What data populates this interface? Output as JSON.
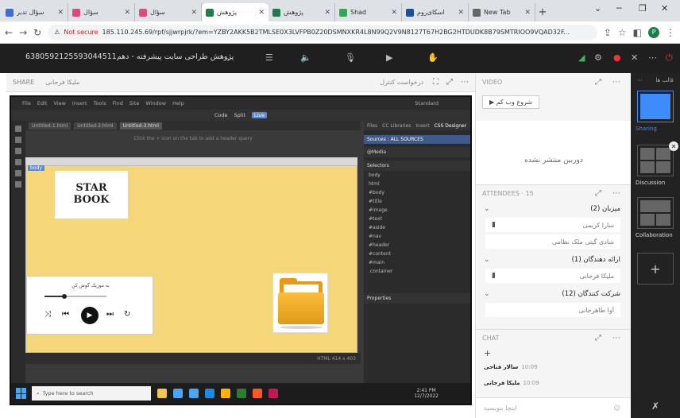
{
  "browser": {
    "tabs": [
      {
        "title": "سؤال تدبر",
        "color": "#3b6fd6"
      },
      {
        "title": "سؤال",
        "color": "#e04a7a"
      },
      {
        "title": "سؤال",
        "color": "#e04a7a"
      },
      {
        "title": "پژوهش",
        "color": "#1a7f4b"
      },
      {
        "title": "پژوهش",
        "color": "#1a7f4b"
      },
      {
        "title": "Shad",
        "color": "#2fa84f"
      },
      {
        "title": "اسکای‌روم",
        "color": "#1d4fa0"
      },
      {
        "title": "New Tab",
        "color": "#666666"
      }
    ],
    "active_tab": 3,
    "new_tab": "+",
    "window_controls": [
      "⌄",
      "─",
      "❐",
      "✕"
    ],
    "not_secure": "Not secure",
    "url": "185.110.245.69/rpf/sjjwrpjrk/?em=YZBY2AKK5B2TMLSE0X3LVFPB0Z20DSMNXKR4L8N99Q2V9N8127T67H2BG2HTDUDK8B79SMTRIOO9VQAD32F...",
    "profile_initial": "P"
  },
  "meeting": {
    "room_title": "6380592125593044511پژوهش طراحی سایت پیشرفته - دهم"
  },
  "share": {
    "label": "SHARE",
    "presenter": "ملیکا فرجانی",
    "request_control": "درخواست کنترل"
  },
  "dreamweaver": {
    "menu": [
      "File",
      "Edit",
      "View",
      "Insert",
      "Tools",
      "Find",
      "Site",
      "Window",
      "Help"
    ],
    "workspace": "Standard",
    "mode_tabs": [
      "Code",
      "Split",
      "Live"
    ],
    "active_mode": "Live",
    "doc_tabs": [
      "Untitled-1.html",
      "Untitled-2.html",
      "Untitled-3.html"
    ],
    "hint": "Click the + icon on the tab to add a header query",
    "body_tag": "body",
    "star_line1": "STAR",
    "star_line2": "BOOK",
    "player_title": "به موزیک گوش کن",
    "player_progress": 0.32,
    "status": "HTML   414 x 403",
    "panel_tabs": [
      "Files",
      "CC Libraries",
      "Insert",
      "CSS Designer"
    ],
    "panel_active": "CSS Designer",
    "panel_rows": [
      "Sources : ALL SOURCES",
      "@Media",
      "Selectors",
      "Properties"
    ],
    "panel_items": [
      "body",
      "html",
      "#body",
      "#title",
      "#image",
      "#text",
      "#aside",
      "#nav",
      "#header",
      "#content",
      "#main",
      ".container"
    ]
  },
  "taskbar": {
    "search_placeholder": "Type here to search",
    "apps": [
      "#f2c94c",
      "#49a6f2",
      "#49a6f2",
      "#1e88e5",
      "#ffb300",
      "#2e7d32",
      "#ff5722",
      "#c2185b"
    ],
    "time": "2:41 PM",
    "date": "12/7/2022"
  },
  "right_panel": {
    "video_title": "VIDEO",
    "share_camera": "شروع وب کم",
    "no_camera": "دوربین منتشر نشده",
    "attendees_title": "ATTENDEES · 15",
    "groups": [
      {
        "label": "میزبان (2)",
        "people": [
          "سارا کریمی",
          "شادی گیتی ملک نظامی"
        ]
      },
      {
        "label": "ارائه دهندگان (1)",
        "people": [
          "ملیکا فرجانی"
        ]
      },
      {
        "label": "شرکت کنندگان (12)",
        "people": [
          "آوا طاهرخانی"
        ]
      }
    ],
    "chat_title": "CHAT",
    "messages": [
      {
        "author": "سالار فتاحی",
        "time": "10:09"
      },
      {
        "author": "ملیکا فرجانی",
        "time": "10:09"
      }
    ],
    "chat_placeholder": "اینجا بنویسید"
  },
  "rail": {
    "tabs": [
      "قالب ها"
    ],
    "layouts": [
      "Sharing",
      "Discussion",
      "Collaboration"
    ]
  }
}
